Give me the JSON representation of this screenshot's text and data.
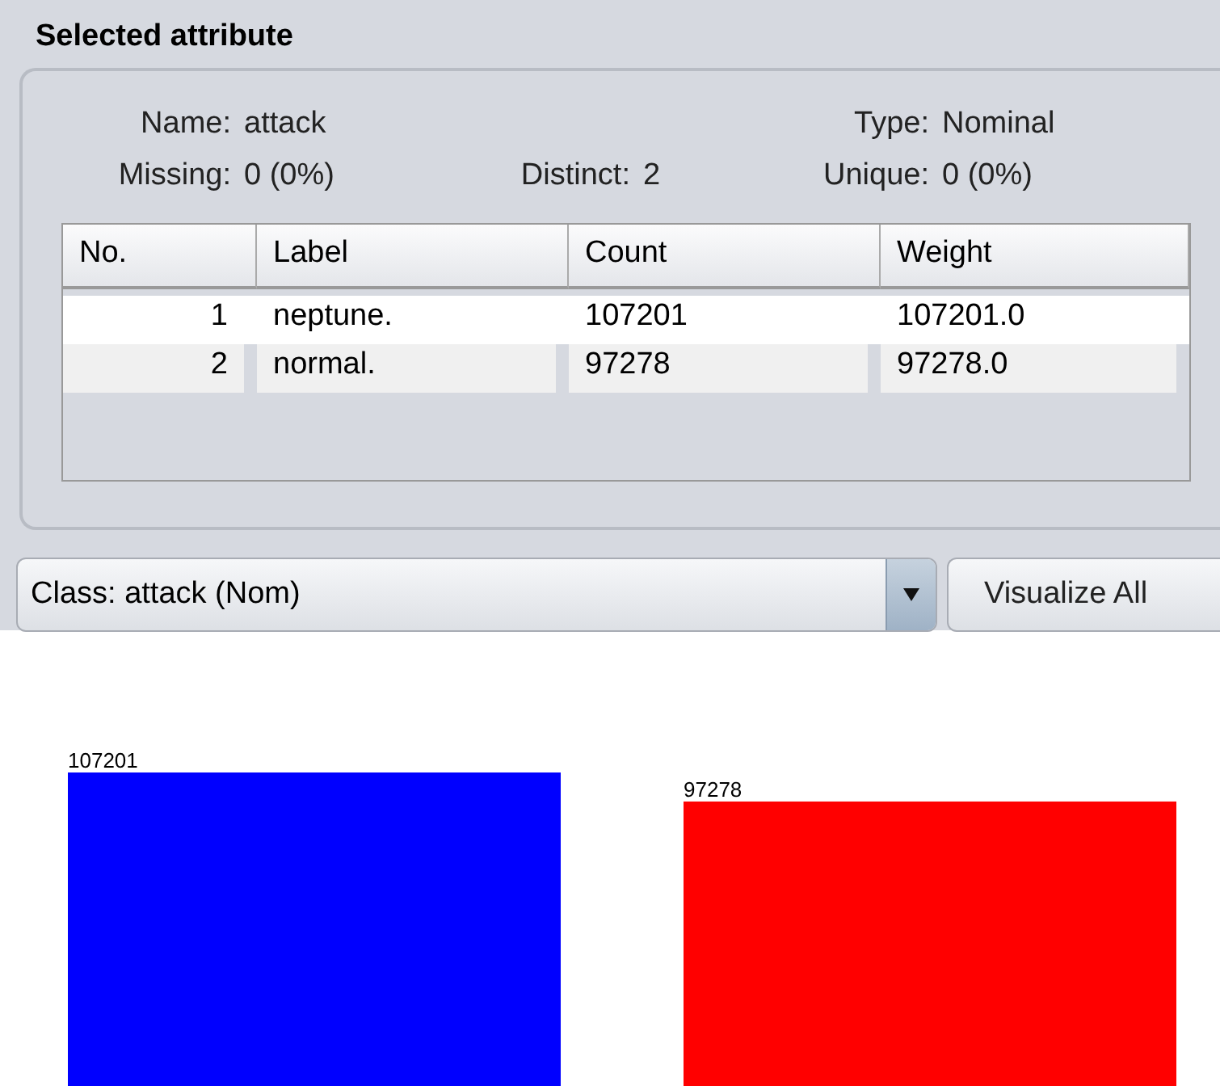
{
  "panel": {
    "title": "Selected attribute"
  },
  "stats": {
    "name": {
      "label": "Name:",
      "value": "attack"
    },
    "type": {
      "label": "Type:",
      "value": "Nominal"
    },
    "missing": {
      "label": "Missing:",
      "value": "0 (0%)"
    },
    "distinct": {
      "label": "Distinct:",
      "value": "2"
    },
    "unique": {
      "label": "Unique:",
      "value": "0 (0%)"
    }
  },
  "table": {
    "columns": [
      "No.",
      "Label",
      "Count",
      "Weight"
    ],
    "rows": [
      [
        "1",
        "neptune.",
        "107201",
        "107201.0"
      ],
      [
        "2",
        "normal.",
        "97278",
        "97278.0"
      ]
    ]
  },
  "class_select": {
    "value": "Class: attack (Nom)"
  },
  "visualize_button": {
    "label": "Visualize All"
  },
  "chart_data": {
    "type": "bar",
    "data_labels": true,
    "series": [
      {
        "color": "#0000ff",
        "values": [
          107201
        ]
      },
      {
        "color": "#ff0000",
        "values": [
          97278
        ]
      }
    ]
  }
}
